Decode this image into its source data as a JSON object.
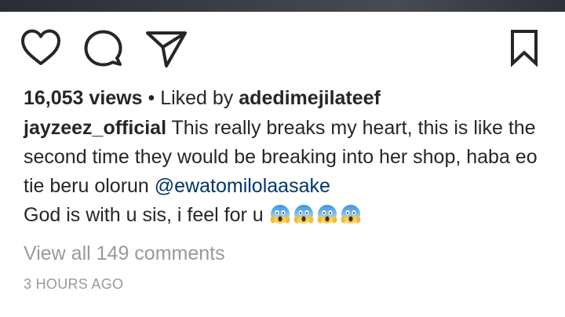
{
  "post": {
    "views": "16,053 views",
    "separator": "•",
    "liked_by_label": "Liked by",
    "liked_by_user": "adedimejilateef",
    "caption": {
      "username": "jayzeez_official",
      "text": "This really breaks my heart, this is like the second time they would be breaking into her shop, haba eo tie beru olorun",
      "mention": "@ewatomilolaasake",
      "text2": "God is with u sis, i feel for u",
      "emojis": [
        "face-screaming-in-fear",
        "face-screaming-in-fear",
        "face-screaming-in-fear",
        "face-screaming-in-fear"
      ]
    },
    "view_comments": "View all 149 comments",
    "timestamp": "3 HOURS AGO"
  },
  "icons": {
    "like": "heart-outline-icon",
    "comment": "comment-bubble-icon",
    "share": "paper-plane-icon",
    "save": "bookmark-outline-icon"
  },
  "colors": {
    "text": "#262626",
    "muted": "#999999",
    "mention": "#003569"
  }
}
